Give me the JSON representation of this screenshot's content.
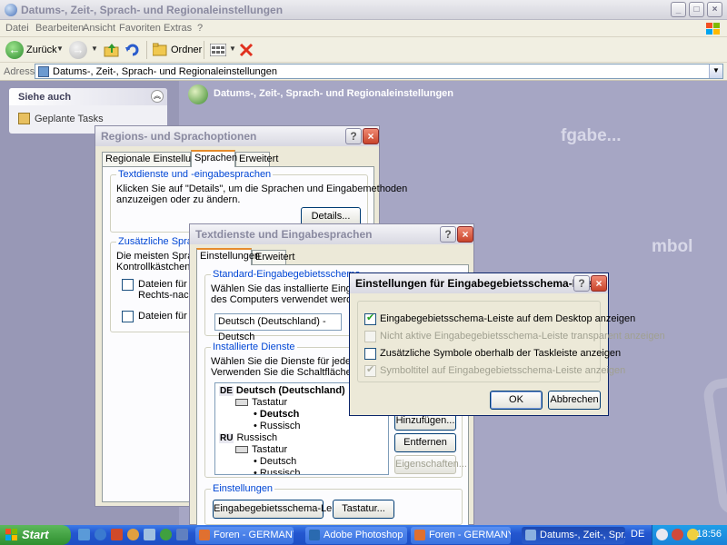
{
  "window": {
    "title": "Datums-, Zeit-, Sprach- und Regionaleinstellungen",
    "controls": {
      "minimize": "_",
      "maximize": "□",
      "close": "×"
    }
  },
  "menu": [
    "Datei",
    "Bearbeiten",
    "Ansicht",
    "Favoriten",
    "Extras",
    "?"
  ],
  "toolbar": {
    "back": "Zurück",
    "folders": "Ordner"
  },
  "address": {
    "label": "Adresse",
    "value": "Datums-, Zeit-, Sprach- und Regionaleinstellungen"
  },
  "sidebar": {
    "see_also": {
      "title": "Siehe auch",
      "items": [
        "Geplante Tasks"
      ]
    }
  },
  "category": {
    "header": "Datums-, Zeit-, Sprach- und Regionaleinstellungen",
    "heading_fragment_1": "fgabe...",
    "heading_fragment_2": "mbol"
  },
  "regional_dialog": {
    "title": "Regions- und Sprachoptionen",
    "tabs": [
      "Regionale Einstellungen",
      "Sprachen",
      "Erweitert"
    ],
    "selected_tab": "Sprachen",
    "group1": {
      "label": "Textdienste und -eingabesprachen",
      "text_lines": [
        "Klicken Sie auf \"Details\", um die Sprachen und Eingabemethoden",
        "anzuzeigen oder zu ändern."
      ],
      "details_button": "Details..."
    },
    "group2": {
      "label": "Zusätzliche Sprachun",
      "text_lines": [
        "Die meisten Sprachen",
        "Kontrollkästchen unte"
      ],
      "checkbox1_lines": [
        "Dateien für Sprac",
        "Rechts-nach-link"
      ],
      "checkbox2": "Dateien für ostas"
    }
  },
  "text_services_dialog": {
    "title": "Textdienste und Eingabesprachen",
    "tabs": [
      "Einstellungen",
      "Erweitert"
    ],
    "selected_tab": "Einstellungen",
    "default_group": {
      "label": "Standard-Eingabegebietsschema",
      "text_lines": [
        "Wählen Sie das installierte Eingabegebiet",
        "des Computers verwendet werden soll."
      ],
      "selected": "Deutsch (Deutschland) - Deutsch"
    },
    "installed_group": {
      "label": "Installierte Dienste",
      "text_lines": [
        "Wählen Sie die Dienste für jedes angezeigte",
        "Verwenden Sie die Schaltflächen \"Hinzu"
      ],
      "tree": [
        {
          "badge": "DE",
          "text": "Deutsch (Deutschland)",
          "bold": true
        },
        {
          "icon": "keyboard-icon",
          "text": "Tastatur"
        },
        {
          "bullet": true,
          "text": "Deutsch",
          "bold": true
        },
        {
          "bullet": true,
          "text": "Russisch"
        },
        {
          "badge": "RU",
          "text": "Russisch"
        },
        {
          "icon": "keyboard-icon",
          "text": "Tastatur"
        },
        {
          "bullet": true,
          "text": "Deutsch"
        },
        {
          "bullet": true,
          "text": "Russisch"
        }
      ],
      "add_button": "Hinzufügen...",
      "remove_button": "Entfernen",
      "properties_button": "Eigenschaften..."
    },
    "settings_group": {
      "label": "Einstellungen",
      "langbar_button": "Eingabegebietsschema-Leiste...",
      "keyboard_button": "Tastatur..."
    }
  },
  "langbar_dialog": {
    "title": "Einstellungen für Eingabegebietsschema-Leiste",
    "options": [
      {
        "label": "Eingabegebietsschema-Leiste auf dem Desktop anzeigen",
        "checked": true,
        "enabled": true
      },
      {
        "label": "Nicht aktive Eingabegebietsschema-Leiste transparent anzeigen",
        "checked": false,
        "enabled": false
      },
      {
        "label": "Zusätzliche Symbole oberhalb der Taskleiste anzeigen",
        "checked": false,
        "enabled": true
      },
      {
        "label": "Symboltitel auf Eingabegebietsschema-Leiste anzeigen",
        "checked": true,
        "enabled": false
      }
    ],
    "ok": "OK",
    "cancel": "Abbrechen"
  },
  "taskbar": {
    "start": "Start",
    "tasks": [
      {
        "label": "Foren - GERMANY.R...",
        "active": false
      },
      {
        "label": "Adobe Photoshop",
        "active": false
      },
      {
        "label": "Foren - GERMANY.R...",
        "active": false
      },
      {
        "label": "Datums-, Zeit-, Spr...",
        "active": true
      }
    ],
    "language": "DE",
    "clock": "18:56"
  },
  "colors": {
    "title_active": "#0a246a",
    "group_label": "#0046d5",
    "close_button": "#c8442a",
    "taskbar": "#2457d0",
    "start_button": "#2f8f2f"
  }
}
